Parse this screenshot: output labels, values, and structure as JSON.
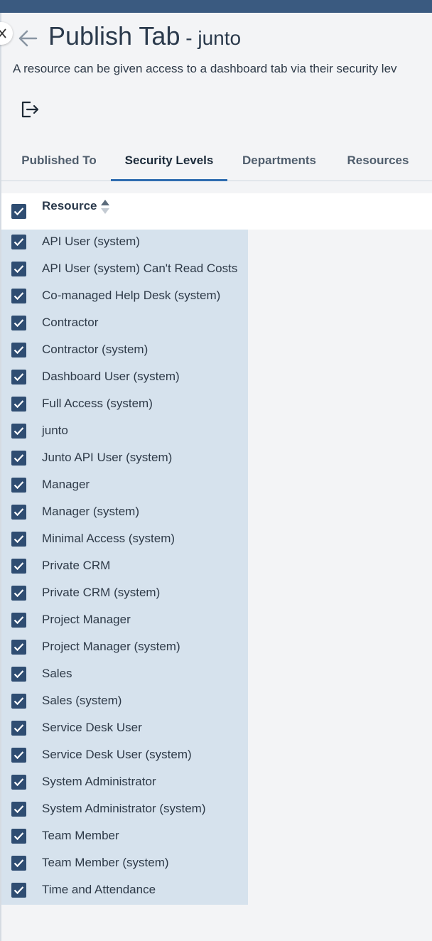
{
  "header": {
    "title": "Publish Tab",
    "separator": " - ",
    "subtitle": "junto",
    "description": "A resource can be given access to a dashboard tab via their security lev"
  },
  "icons": {
    "close": "close-icon",
    "back": "arrow-left-icon",
    "export": "export-icon",
    "sort": "sort-icon",
    "check": "checkmark-icon"
  },
  "tabs": [
    {
      "label": "Published To",
      "active": false
    },
    {
      "label": "Security Levels",
      "active": true
    },
    {
      "label": "Departments",
      "active": false
    },
    {
      "label": "Resources",
      "active": false
    }
  ],
  "table": {
    "column_header": "Resource",
    "select_all_checked": true,
    "rows": [
      {
        "label": "API User (system)",
        "checked": true
      },
      {
        "label": "API User (system) Can't Read Costs",
        "checked": true
      },
      {
        "label": "Co-managed Help Desk (system)",
        "checked": true
      },
      {
        "label": "Contractor",
        "checked": true
      },
      {
        "label": "Contractor (system)",
        "checked": true
      },
      {
        "label": "Dashboard User (system)",
        "checked": true
      },
      {
        "label": "Full Access (system)",
        "checked": true
      },
      {
        "label": "junto",
        "checked": true
      },
      {
        "label": "Junto API User (system)",
        "checked": true
      },
      {
        "label": "Manager",
        "checked": true
      },
      {
        "label": "Manager (system)",
        "checked": true
      },
      {
        "label": "Minimal Access (system)",
        "checked": true
      },
      {
        "label": "Private CRM",
        "checked": true
      },
      {
        "label": "Private CRM (system)",
        "checked": true
      },
      {
        "label": "Project Manager",
        "checked": true
      },
      {
        "label": "Project Manager (system)",
        "checked": true
      },
      {
        "label": "Sales",
        "checked": true
      },
      {
        "label": "Sales (system)",
        "checked": true
      },
      {
        "label": "Service Desk User",
        "checked": true
      },
      {
        "label": "Service Desk User (system)",
        "checked": true
      },
      {
        "label": "System Administrator",
        "checked": true
      },
      {
        "label": "System Administrator (system)",
        "checked": true
      },
      {
        "label": "Team Member",
        "checked": true
      },
      {
        "label": "Team Member (system)",
        "checked": true
      },
      {
        "label": "Time and Attendance",
        "checked": true
      }
    ]
  },
  "colors": {
    "topbar": "#3a5a80",
    "accent": "#2f6db0",
    "checkbox": "#2f4d72",
    "row_selected_bg": "#d6e2ed",
    "page_bg": "#f3f4f6"
  }
}
